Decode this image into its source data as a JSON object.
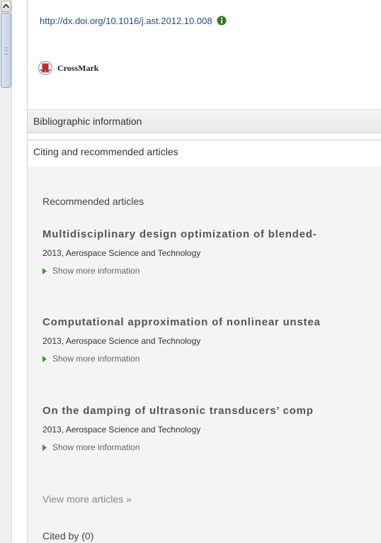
{
  "scrollbar": {
    "position_fraction": 0.03
  },
  "doi": {
    "link": "http://dx.doi.org/10.1016/j.ast.2012.10.008",
    "info_icon": "info-icon"
  },
  "crossmark": {
    "label": "CrossMark",
    "icon": "crossmark-icon"
  },
  "sections": {
    "bibliographic": "Bibliographic information",
    "citing": "Citing and recommended articles"
  },
  "recommended": {
    "heading": "Recommended articles",
    "articles": [
      {
        "title": "Multidisciplinary design optimization of blended-",
        "meta": "2013, Aerospace Science and Technology",
        "more": "Show more information"
      },
      {
        "title": "Computational approximation of nonlinear unstea",
        "meta": "2013, Aerospace Science and Technology",
        "more": "Show more information"
      },
      {
        "title": "On the damping of ultrasonic transducers’ comp",
        "meta": "2013, Aerospace Science and Technology",
        "more": "Show more information"
      }
    ],
    "view_more": "View more articles »"
  },
  "cited_by": "Cited by (0)",
  "colors": {
    "link": "#1e4b8f",
    "info_green": "#2e7d1f",
    "crossmark_red": "#c8281e",
    "triangle_green": "#3a9a2a"
  }
}
